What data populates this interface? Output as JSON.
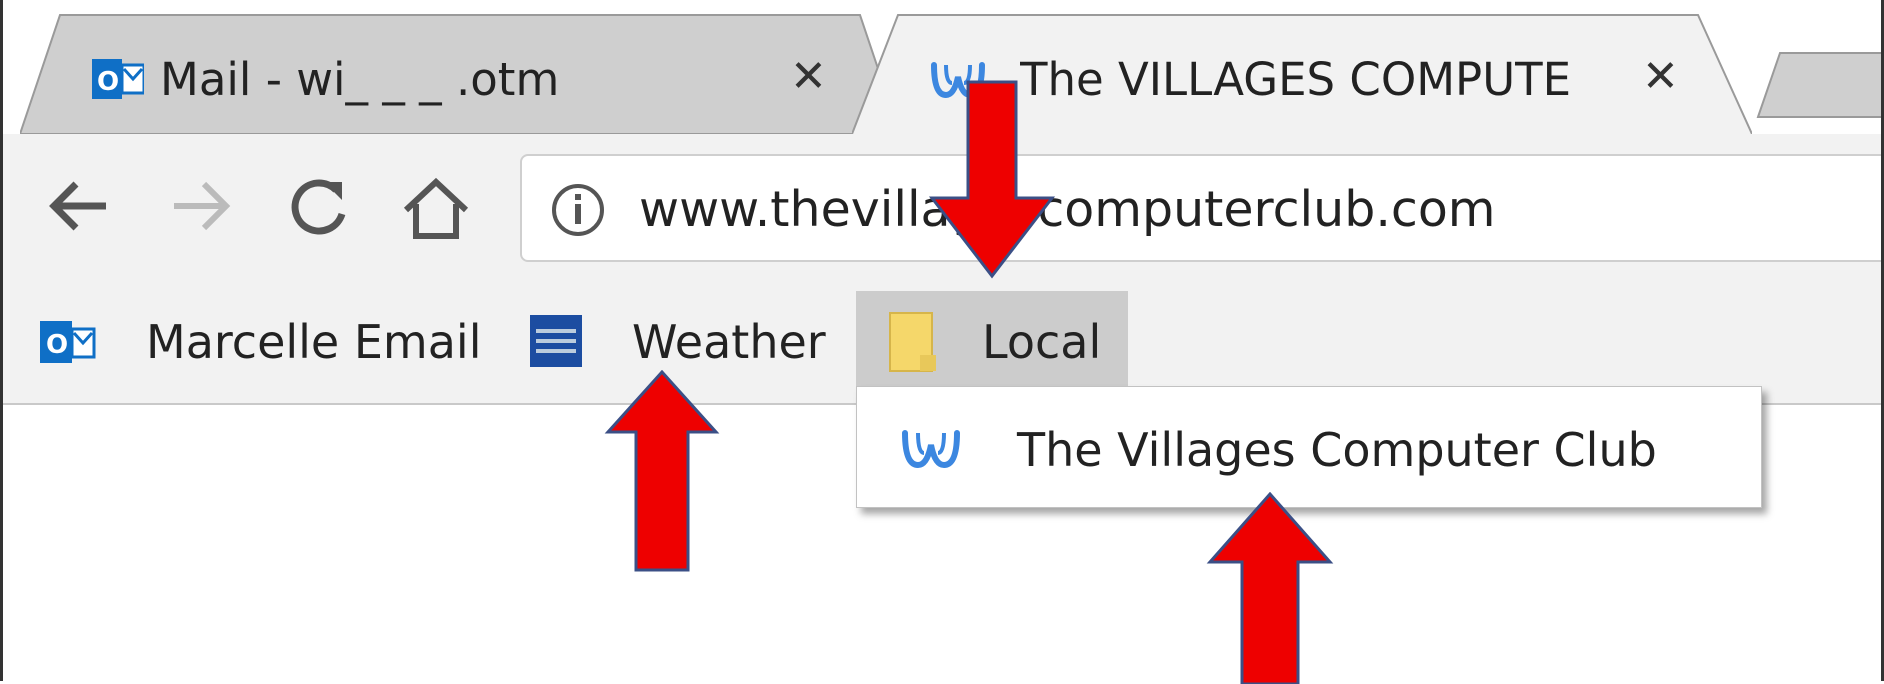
{
  "tabs": [
    {
      "title": "Mail - wi_ _ _ .otm",
      "favicon": "outlook-icon",
      "active": false
    },
    {
      "title": "The VILLAGES COMPUTE",
      "favicon": "weebly-icon",
      "active": true
    }
  ],
  "toolbar": {
    "url": "www.thevillagescomputerclub.com"
  },
  "bookmarks": [
    {
      "label": "Marcelle Email",
      "icon": "outlook-icon"
    },
    {
      "label": "Weather",
      "icon": "weather-channel-icon"
    },
    {
      "label": "Local",
      "icon": "folder-icon"
    }
  ],
  "dropdown": {
    "items": [
      {
        "label": "The Villages Computer Club",
        "icon": "weebly-icon"
      }
    ]
  },
  "colors": {
    "arrow": "#ee0000",
    "arrow_outline": "#3b4f86",
    "outlook_blue": "#0f6fc6",
    "folder_yellow": "#f5d76a",
    "weebly_blue": "#3c87e0"
  }
}
